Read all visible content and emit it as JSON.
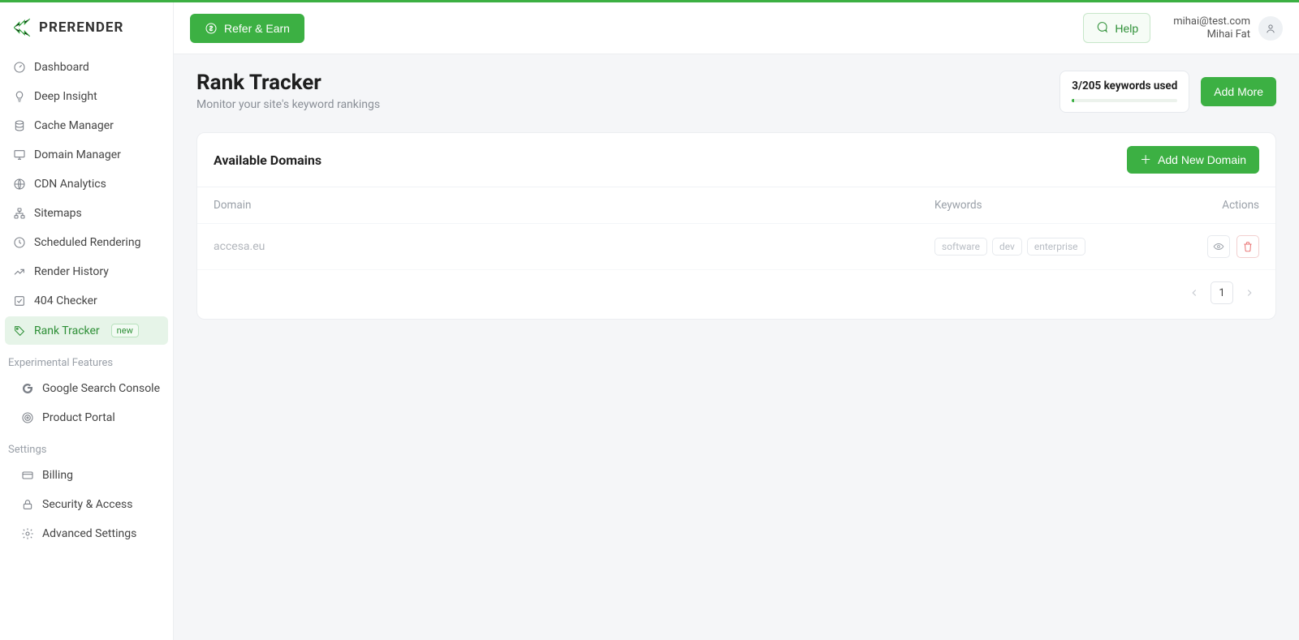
{
  "brand": {
    "name": "PRERENDER"
  },
  "sidebar": {
    "main": [
      {
        "label": "Dashboard",
        "icon": "gauge"
      },
      {
        "label": "Deep Insight",
        "icon": "bulb"
      },
      {
        "label": "Cache Manager",
        "icon": "database"
      },
      {
        "label": "Domain Manager",
        "icon": "monitor"
      },
      {
        "label": "CDN Analytics",
        "icon": "globe"
      },
      {
        "label": "Sitemaps",
        "icon": "sitemap"
      },
      {
        "label": "Scheduled Rendering",
        "icon": "clock"
      },
      {
        "label": "Render History",
        "icon": "trend"
      },
      {
        "label": "404 Checker",
        "icon": "check-square"
      },
      {
        "label": "Rank Tracker",
        "icon": "tag",
        "badge": "new",
        "active": true
      }
    ],
    "groups": [
      {
        "label": "Experimental Features",
        "items": [
          {
            "label": "Google Search Console",
            "icon": "google"
          },
          {
            "label": "Product Portal",
            "icon": "target"
          }
        ]
      },
      {
        "label": "Settings",
        "items": [
          {
            "label": "Billing",
            "icon": "card"
          },
          {
            "label": "Security & Access",
            "icon": "lock"
          },
          {
            "label": "Advanced Settings",
            "icon": "gear"
          }
        ]
      }
    ]
  },
  "topbar": {
    "refer_label": "Refer & Earn",
    "help_label": "Help",
    "user": {
      "email": "mihai@test.com",
      "name": "Mihai Fat"
    }
  },
  "page": {
    "title": "Rank Tracker",
    "subtitle": "Monitor your site's keyword rankings",
    "usage_label": "3/205 keywords used",
    "usage_percent": 1.46,
    "add_more_label": "Add More"
  },
  "panel": {
    "title": "Available Domains",
    "add_domain_label": "Add New Domain",
    "columns": {
      "domain": "Domain",
      "keywords": "Keywords",
      "actions": "Actions"
    },
    "rows": [
      {
        "domain": "accesa.eu",
        "keywords": [
          "software",
          "dev",
          "enterprise"
        ]
      }
    ],
    "pagination": {
      "current": "1"
    }
  }
}
